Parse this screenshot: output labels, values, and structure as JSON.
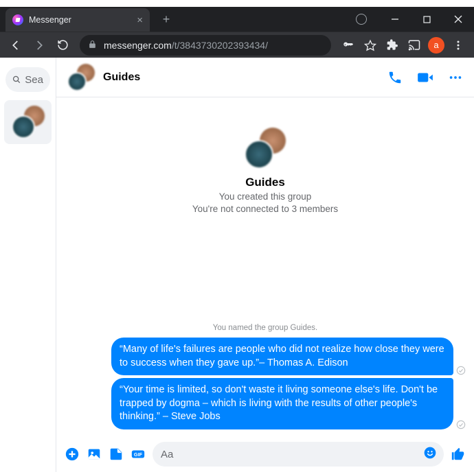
{
  "browser": {
    "tab_title": "Messenger",
    "url_host": "messenger.com",
    "url_path": "/t/3843730202393434/",
    "profile_initial": "a"
  },
  "sidebar": {
    "search_placeholder": "Sea"
  },
  "conversation": {
    "title": "Guides",
    "info_title": "Guides",
    "info_line1": "You created this group",
    "info_line2": "You're not connected to 3 members",
    "system_message": "You named the group Guides.",
    "messages": [
      {
        "text": "“Many of life's failures are people who did not realize how close they were to success when they gave up.”– Thomas A. Edison"
      },
      {
        "text": "“Your time is limited, so don't waste it living someone else's life. Don't be trapped by dogma – which is living with the results of other people's thinking.” – Steve Jobs"
      }
    ]
  },
  "composer": {
    "placeholder": "Aa"
  }
}
